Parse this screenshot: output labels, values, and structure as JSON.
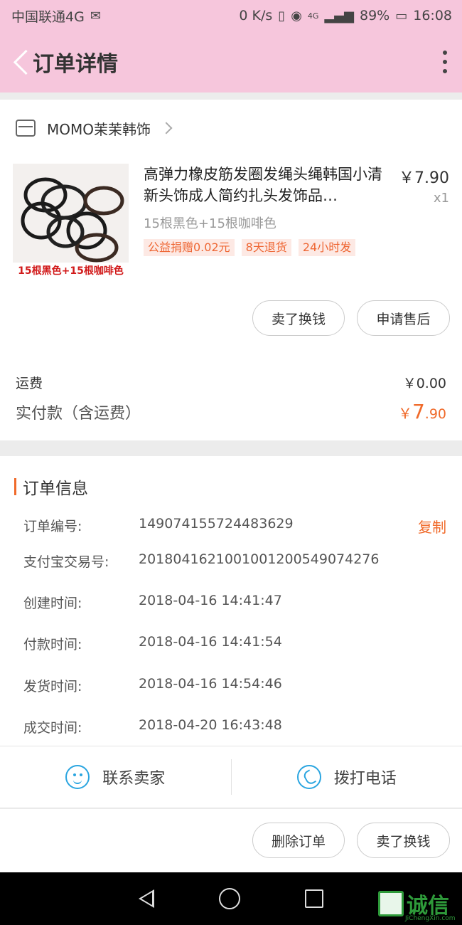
{
  "status_bar": {
    "carrier": "中国联通4G",
    "speed": "0 K/s",
    "network": "4G",
    "battery": "89%",
    "time": "16:08"
  },
  "nav": {
    "title": "订单详情"
  },
  "shop": {
    "name": "MOMO茉茉韩饰"
  },
  "product": {
    "title": "高弹力橡皮筋发圈发绳头绳韩国小清新头饰成人简约扎头发饰品…",
    "price": "￥7.90",
    "quantity": "x1",
    "sku": "15根黑色+15根咖啡色",
    "thumb_caption": "15根黑色+15根咖啡色",
    "tags": [
      "公益捐赠0.02元",
      "8天退货",
      "24小时发"
    ]
  },
  "actions_top": {
    "sell_label": "卖了换钱",
    "after_sale_label": "申请售后"
  },
  "fees": {
    "shipping_label": "运费",
    "shipping_value": "￥0.00",
    "paid_label": "实付款（含运费）",
    "paid_currency": "￥",
    "paid_integer": "7",
    "paid_decimal": ".90"
  },
  "order_info": {
    "title": "订单信息",
    "copy_label": "复制",
    "rows": [
      {
        "label": "订单编号:",
        "value": "149074155724483629"
      },
      {
        "label": "支付宝交易号:",
        "value": "2018041621001001200549074276"
      },
      {
        "label": "创建时间:",
        "value": "2018-04-16 14:41:47"
      },
      {
        "label": "付款时间:",
        "value": "2018-04-16 14:41:54"
      },
      {
        "label": "发货时间:",
        "value": "2018-04-16 14:54:46"
      },
      {
        "label": "成交时间:",
        "value": "2018-04-20 16:43:48"
      }
    ]
  },
  "contact": {
    "seller_label": "联系卖家",
    "call_label": "拨打电话"
  },
  "actions_bottom": {
    "delete_label": "删除订单",
    "sell_label": "卖了换钱"
  },
  "watermark": {
    "text": "诚信",
    "sub": "JiChengXin.com"
  },
  "colors": {
    "header_bg": "#f6c6dc",
    "accent": "#f06a2a",
    "icon_blue": "#2aa5e0"
  }
}
